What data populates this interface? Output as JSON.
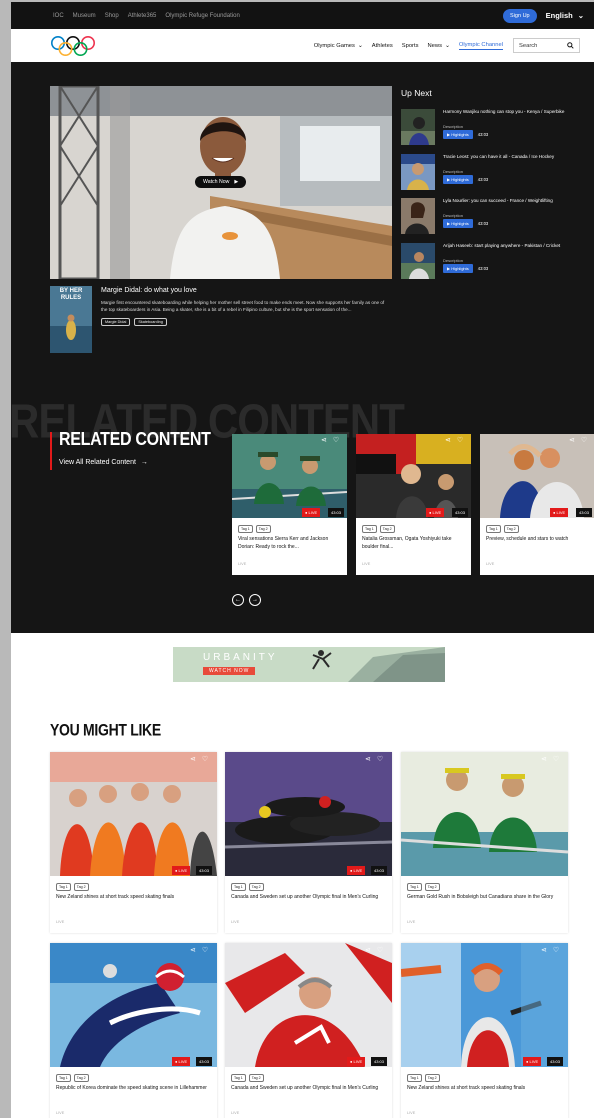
{
  "topbar": {
    "links": [
      "IOC",
      "Museum",
      "Shop",
      "Athlete365",
      "Olympic Refuge Foundation"
    ],
    "signup": "Sign Up",
    "language": "English"
  },
  "nav": {
    "items": [
      "Olympic Games",
      "Athletes",
      "Sports",
      "News",
      "Olympic Channel"
    ],
    "search_placeholder": "Search"
  },
  "hero": {
    "watch_now": "Watch Now",
    "book_title": "BY HER RULES",
    "title": "Margie Didal: do what you love",
    "description": "Margie first encountered skateboarding while helping her mother sell street food to make ends meet. Now she supports her family as one of the top skateboarders in Asia. Being a skater, she is a bit of a rebel in Filipino culture, but she is the sport sensation of the...",
    "tags": [
      "Margie Didal",
      "Skateboarding"
    ]
  },
  "up_next": {
    "heading": "Up Next",
    "items": [
      {
        "title": "Harmony Wanjiku nothing can stop you - Kenya / Superbike",
        "desc": "Description",
        "badge": "Highlights",
        "time": "43:03"
      },
      {
        "title": "Tracie Leost: you can have it all - Canada / Ice Hockey",
        "desc": "Description",
        "badge": "Highlights",
        "time": "43:03"
      },
      {
        "title": "Lyla Nourlier: you can succeed - France / Weightlifting",
        "desc": "Description",
        "badge": "Highlights",
        "time": "43:03"
      },
      {
        "title": "Arijah Haseeb: start playing anywhere - Pakistan / Cricket",
        "desc": "Description",
        "badge": "Highlights",
        "time": "43:03"
      }
    ]
  },
  "related": {
    "ghost": "RELATED CONTENT",
    "title": "RELATED CONTENT",
    "link": "View All Related Content",
    "cards": [
      {
        "tags": [
          "Tag 1",
          "Tag 2"
        ],
        "title": "Viral sensations Sierra Kerr and Jackson Dorian: Ready to rock the...",
        "live": "LIVE",
        "badge": "LIVE",
        "time": "43:03"
      },
      {
        "tags": [
          "Tag 1",
          "Tag 2"
        ],
        "title": "Natalia Grossman, Ogata Yoshiyuki take boulder final...",
        "live": "LIVE",
        "badge": "LIVE",
        "time": "43:03"
      },
      {
        "tags": [
          "Tag 1",
          "Tag 2"
        ],
        "title": "Preview, schedule and stars to watch",
        "live": "LIVE",
        "badge": "LIVE",
        "time": "43:03"
      }
    ]
  },
  "banner": {
    "title": "URBANITY",
    "cta": "WATCH NOW"
  },
  "you_might_like": {
    "title": "YOU MIGHT LIKE",
    "cards": [
      {
        "tags": [
          "Tag 1",
          "Tag 2"
        ],
        "title": "New Zeland shines at short track speed skating finals",
        "live": "LIVE",
        "badge": "LIVE",
        "time": "43:03"
      },
      {
        "tags": [
          "Tag 1",
          "Tag 2"
        ],
        "title": "Canada and Sweden set up another Olympic final in Men's Curling",
        "live": "LIVE",
        "badge": "LIVE",
        "time": "43:03"
      },
      {
        "tags": [
          "Tag 1",
          "Tag 2"
        ],
        "title": "German Gold Rush in Bobsleigh but Canadians share in the Glory",
        "live": "LIVE",
        "badge": "LIVE",
        "time": "43:03"
      },
      {
        "tags": [
          "Tag 1",
          "Tag 2"
        ],
        "title": "Republic of Korea dominate the speed skating scene in Lillehammer",
        "live": "LIVE",
        "badge": "LIVE",
        "time": "43:03"
      },
      {
        "tags": [
          "Tag 1",
          "Tag 2"
        ],
        "title": "Canada and Sweden set up another Olympic final in Men's Curling",
        "live": "LIVE",
        "badge": "LIVE",
        "time": "43:03"
      },
      {
        "tags": [
          "Tag 1",
          "Tag 2"
        ],
        "title": "New Zeland shines at short track speed skating finals",
        "live": "LIVE",
        "badge": "LIVE",
        "time": "43:03"
      }
    ]
  },
  "colors": {
    "accent": "#2f6bd8",
    "live_red": "#e21a1a",
    "dark_bg": "#151515"
  }
}
